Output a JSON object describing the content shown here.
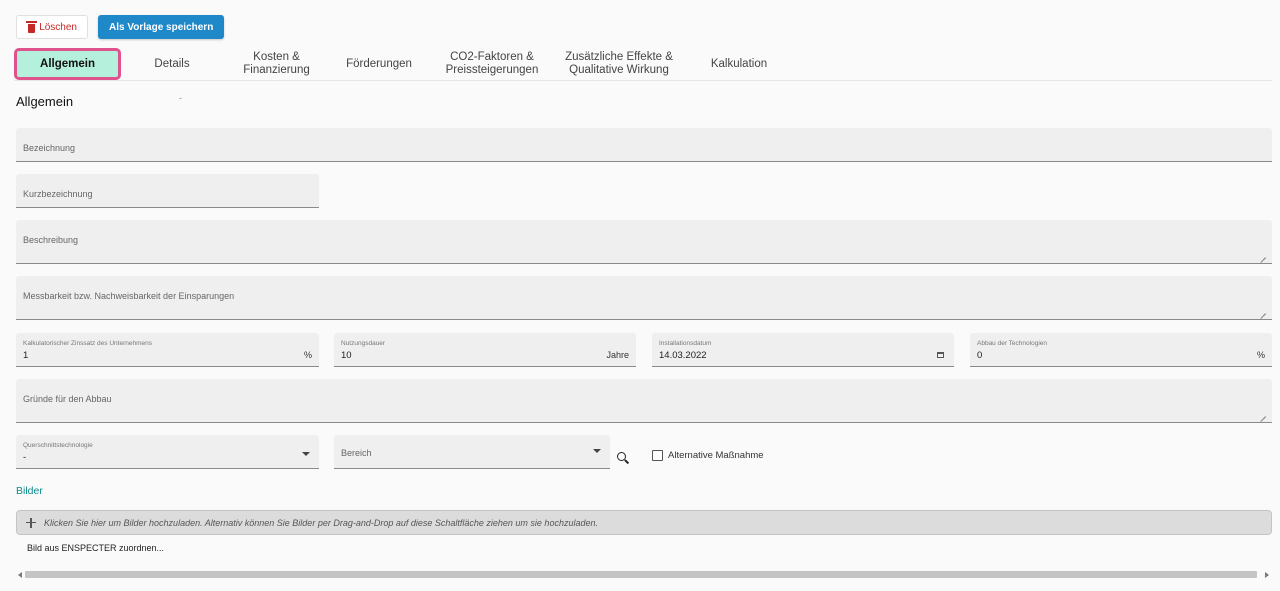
{
  "toolbar": {
    "delete_label": "Löschen",
    "save_template_label": "Als Vorlage speichern"
  },
  "tabs": [
    {
      "label": "Allgemein",
      "active": true
    },
    {
      "label": "Details"
    },
    {
      "label": "Kosten &\nFinanzierung"
    },
    {
      "label": "Förderungen"
    },
    {
      "label": "CO2-Faktoren &\nPreissteigerungen"
    },
    {
      "label": "Zusätzliche Effekte &\nQualitative Wirkung"
    },
    {
      "label": "Kalkulation"
    }
  ],
  "section": {
    "title": "Allgemein",
    "dash": "-"
  },
  "form": {
    "bezeichnung": {
      "label": "Bezeichnung"
    },
    "kurzbezeichnung": {
      "label": "Kurzbezeichnung"
    },
    "beschreibung": {
      "label": "Beschreibung"
    },
    "messbarkeit": {
      "label": "Messbarkeit bzw. Nachweisbarkeit der Einsparungen"
    },
    "zinssatz": {
      "label": "Kalkulatorischer Zinssatz des Unternehmens",
      "value": "1",
      "suffix": "%"
    },
    "nutzungsdauer": {
      "label": "Nutzungsdauer",
      "value": "10",
      "suffix": "Jahre"
    },
    "installationsdatum": {
      "label": "Installationsdatum",
      "value": "14.03.2022"
    },
    "abbau": {
      "label": "Abbau der Technologien",
      "value": "0",
      "suffix": "%"
    },
    "gruende": {
      "label": "Gründe für den Abbau"
    },
    "querschnitt": {
      "label": "Querschnittstechnologie",
      "value": "-"
    },
    "bereich": {
      "label": "Bereich"
    },
    "alternative": {
      "label": "Alternative Maßnahme",
      "checked": false
    }
  },
  "bilder": {
    "title": "Bilder",
    "upload_hint": "Klicken Sie hier um Bilder hochzuladen. Alternativ können Sie Bilder per Drag-and-Drop auf diese Schaltfläche ziehen um sie hochzuladen.",
    "assign_link": "Bild aus ENSPECTER zuordnen..."
  },
  "colors": {
    "primary": "#1e88c8",
    "delete": "#c62828",
    "active_tab_bg": "#b4f0dc",
    "active_tab_border": "#e0528c",
    "link_teal": "#0b8a8a"
  }
}
